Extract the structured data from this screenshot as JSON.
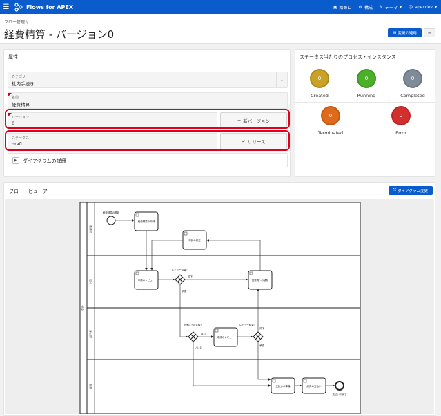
{
  "app": {
    "title": "Flows for APEX"
  },
  "topnav": {
    "start": "始めに",
    "config": "構成",
    "theme": "テーマ",
    "user": "apexdev"
  },
  "breadcrumb": "フロー管理",
  "page": {
    "title": "経費精算 - バージョン0"
  },
  "header": {
    "apply_label": "変更の適用"
  },
  "attributes": {
    "title": "属性",
    "category": {
      "label": "カテゴリー",
      "value": "社内手続き"
    },
    "name": {
      "label": "名前",
      "value": "経費精算"
    },
    "version": {
      "label": "バージョン",
      "value": "0"
    },
    "new_version_button": "新バージョン",
    "status": {
      "label": "ステータス",
      "value": "draft"
    },
    "release_button": "リリース",
    "diagram_details": "ダイアグラムの詳細"
  },
  "instances": {
    "title": "ステータス当たりのプロセス・インスタンス",
    "items": [
      {
        "label": "Created",
        "count": "0",
        "color": "#c9a227"
      },
      {
        "label": "Running",
        "count": "0",
        "color": "#4caf2a"
      },
      {
        "label": "Completed",
        "count": "0",
        "color": "#7f8b98"
      },
      {
        "label": "Terminated",
        "count": "0",
        "color": "#e06a1b"
      },
      {
        "label": "Error",
        "count": "0",
        "color": "#d42f2f"
      }
    ]
  },
  "viewer": {
    "title": "フロー・ビューアー",
    "change_button": "ダイアグラム変更",
    "diagram": {
      "pool_label": "会社",
      "lanes": [
        "従業員",
        "上司",
        "部門長",
        "経理"
      ],
      "start_event": "経費精算の開始",
      "end_event": "支払いの完了",
      "tasks": {
        "apply": "経費精算の申請",
        "fix": "申請の修正",
        "review1": "申請のレビュー",
        "notify": "従業員への通知",
        "review2": "申請のレビュー",
        "prep": "支払いの準備",
        "pay": "経費の支払い"
      },
      "gateways": {
        "g1": "レビュー結果？",
        "g2": "50K以上の金額？",
        "g3": "レビュー結果？"
      },
      "flows": {
        "reject1": "却下",
        "approve1": "承認",
        "yes": "はい",
        "no": "いいえ",
        "reject2": "却下",
        "approve2": "承認"
      }
    }
  }
}
